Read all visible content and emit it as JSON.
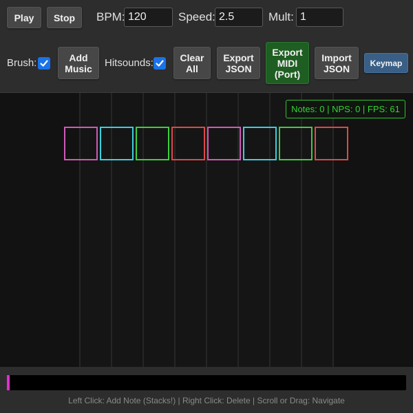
{
  "toolbar": {
    "play_label": "Play",
    "stop_label": "Stop",
    "bpm_label": "BPM:",
    "bpm_value": "120",
    "speed_label": "Speed:",
    "speed_value": "2.5",
    "mult_label": "Mult:",
    "mult_value": "1",
    "brush_label": "Brush:",
    "brush_checked": true,
    "add_music_label": "Add Music",
    "hitsounds_label": "Hitsounds:",
    "hitsounds_checked": true,
    "clear_all_label": "Clear All",
    "export_json_label": "Export JSON",
    "export_midi_label": "Export MIDI (Port)",
    "import_json_label": "Import JSON",
    "keymap_label": "Keymap"
  },
  "stats": {
    "text": "Notes: 0 | NPS: 0 | FPS: 61"
  },
  "receptors": [
    {
      "lane": 1,
      "color": "#d05ab8"
    },
    {
      "lane": 2,
      "color": "#3ccfe0"
    },
    {
      "lane": 3,
      "color": "#3fcf3f"
    },
    {
      "lane": 4,
      "color": "#e04848"
    },
    {
      "lane": 5,
      "color": "#d05ab8"
    },
    {
      "lane": 6,
      "color": "#3ccfe0"
    },
    {
      "lane": 7,
      "color": "#3fcf3f"
    },
    {
      "lane": 8,
      "color": "#e04848"
    }
  ],
  "timeline": {
    "progress": 0,
    "playhead_color": "#e22fd0"
  },
  "help_text": "Left Click: Add Note (Stacks!) | Right Click: Delete | Scroll or Drag: Navigate",
  "colors": {
    "accent_green": "#33d433",
    "checkbox_blue": "#1a73e8",
    "keymap_blue": "#3a5f86",
    "export_midi_green": "#1f5e22"
  }
}
